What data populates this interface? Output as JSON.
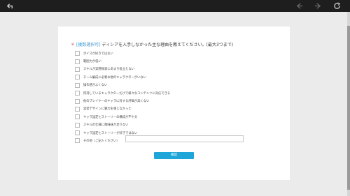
{
  "question": {
    "required_mark": "＊",
    "tag": "[複数選択可]",
    "text": "ディシアを入手しなかった主な理由を教えてください。(最大3つまで)"
  },
  "options": [
    {
      "label": "ボイスが好きではない"
    },
    {
      "label": "範囲力が低い"
    },
    {
      "label": "スキルが実際探索にあまり役立たない"
    },
    {
      "label": "チーム編成に必要な他のキャラクターがいない"
    },
    {
      "label": "操作感がよくない"
    },
    {
      "label": "所持しているキャラクターだけで様々なコンテンツに対応できる"
    },
    {
      "label": "他のプレイヤーのキャラに対する評価が高くない"
    },
    {
      "label": "実装デザインに魅力を感じなかった"
    },
    {
      "label": "キャラ設定とストーリーの構成が不十分"
    },
    {
      "label": "スキルの仕様に興味味が足りない"
    },
    {
      "label": "キャラ設定とストーリーが好きではない"
    },
    {
      "label": "その他（ご記入ください）"
    }
  ],
  "other_input": {
    "value": ""
  },
  "confirm_button": {
    "label": "確認"
  }
}
